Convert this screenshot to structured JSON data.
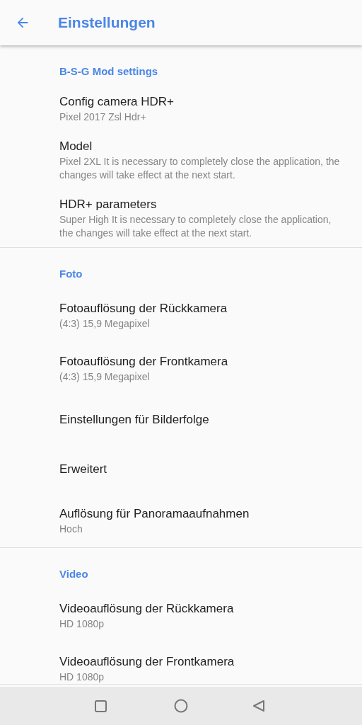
{
  "app_bar": {
    "title": "Einstellungen"
  },
  "sections": [
    {
      "title": "B-S-G Mod settings",
      "items": [
        {
          "title": "Config camera HDR+",
          "summary": "Pixel 2017 Zsl Hdr+"
        },
        {
          "title": "Model",
          "summary": "Pixel 2XL It is necessary to completely close the application, the changes will take effect at the next start."
        },
        {
          "title": "HDR+ parameters",
          "summary": "Super High It is necessary to completely close the application, the changes will take effect at the next start."
        }
      ]
    },
    {
      "title": "Foto",
      "items": [
        {
          "title": "Fotoauflösung der Rückkamera",
          "summary": "(4:3) 15,9 Megapixel"
        },
        {
          "title": "Fotoauflösung der Frontkamera",
          "summary": "(4:3) 15,9 Megapixel"
        },
        {
          "title": "Einstellungen für Bilderfolge"
        },
        {
          "title": "Erweitert"
        },
        {
          "title": "Auflösung für Panoramaaufnahmen",
          "summary": "Hoch"
        }
      ]
    },
    {
      "title": "Video",
      "items": [
        {
          "title": "Videoauflösung der Rückkamera",
          "summary": "HD 1080p"
        },
        {
          "title": "Videoauflösung der Frontkamera",
          "summary": "HD 1080p"
        }
      ]
    }
  ]
}
